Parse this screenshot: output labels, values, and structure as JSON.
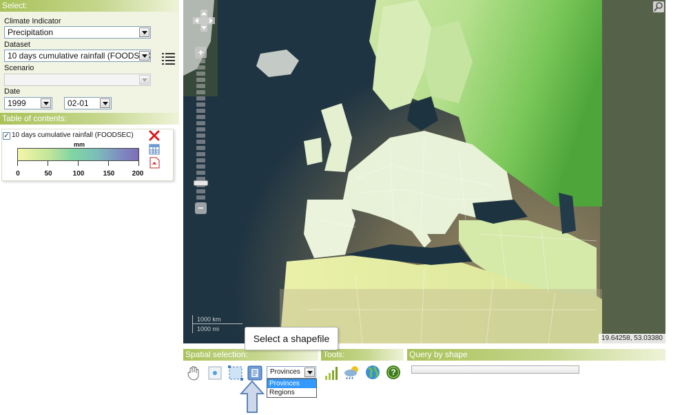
{
  "select_panel": {
    "header": "Select:",
    "climate_indicator": {
      "label": "Climate Indicator",
      "value": "Precipitation"
    },
    "dataset": {
      "label": "Dataset",
      "value": "10 days cumulative rainfall (FOODSEC)"
    },
    "scenario": {
      "label": "Scenario",
      "value": ""
    },
    "date": {
      "label": "Date",
      "year": "1999",
      "day": "02-01"
    }
  },
  "toc": {
    "header": "Table of contents:",
    "layer_name": "10 days cumulative rainfall (FOODSEC)",
    "unit": "mm",
    "ticks": [
      "0",
      "50",
      "100",
      "150",
      "200"
    ],
    "colors": {
      "low": "#f4f6a8",
      "mid": "#7fd6a2",
      "high": "#7e6db6"
    }
  },
  "map": {
    "coordinates": "19.64258, 53.03380",
    "scale_km": "1000 km",
    "scale_mi": "1000 mi",
    "zoom_in": "+",
    "zoom_out": "−"
  },
  "tooltip": "Select a shapefile",
  "spatial_selection": {
    "header": "Spatial selection:",
    "shape_value": "Provinces",
    "options": [
      "Provinces",
      "Regions"
    ]
  },
  "tools": {
    "header": "Tools:"
  },
  "query": {
    "header": "Query by shape"
  },
  "icons": [
    "list-icon",
    "remove-layer-icon",
    "table-icon",
    "pdf-icon",
    "pan-hand-icon",
    "select-point-icon",
    "select-box-icon",
    "select-shapefile-icon",
    "chart-icon",
    "weather-icon",
    "globe-icon",
    "help-icon",
    "arrow-up-icon",
    "search-icon",
    "pan-control-icon"
  ]
}
